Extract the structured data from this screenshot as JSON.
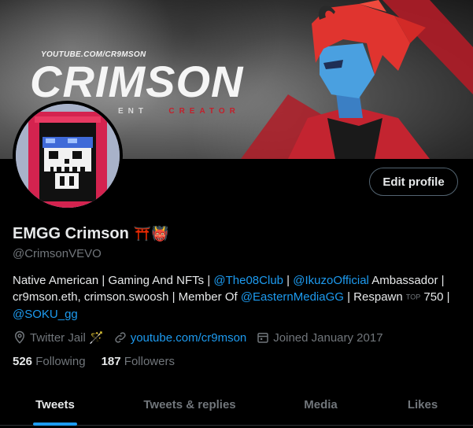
{
  "banner": {
    "url_text": "YOUTUBE.COM/CR9MSON",
    "title": "CRIMSON",
    "subtitle_left": "ENT",
    "subtitle_right": "CREATOR"
  },
  "profile": {
    "edit_label": "Edit profile",
    "name": "EMGG Crimson",
    "name_emojis": "⛩️👹",
    "handle": "@CrimsonVEVO",
    "bio": {
      "t1": "Native American | Gaming And NFTs | ",
      "l1": "@The08Club",
      "t2": " | ",
      "l2": "@IkuzoOfficial",
      "t3": " Ambassador | cr9mson.eth, crimson.swoosh | Member Of ",
      "l3": "@EasternMediaGG",
      "t4": " | Respawn ",
      "top_badge": "TOP",
      "t5": " 750 | ",
      "l4": "@SOKU_gg"
    },
    "location": "Twitter Jail 🪄",
    "website": "youtube.com/cr9mson",
    "joined": "Joined January 2017",
    "following_count": "526",
    "following_label": "Following",
    "followers_count": "187",
    "followers_label": "Followers"
  },
  "tabs": [
    {
      "label": "Tweets",
      "active": true
    },
    {
      "label": "Tweets & replies",
      "active": false
    },
    {
      "label": "Media",
      "active": false
    },
    {
      "label": "Likes",
      "active": false
    }
  ],
  "colors": {
    "accent": "#1d9bf0",
    "muted": "#71767b",
    "brand_red": "#c3202b"
  }
}
